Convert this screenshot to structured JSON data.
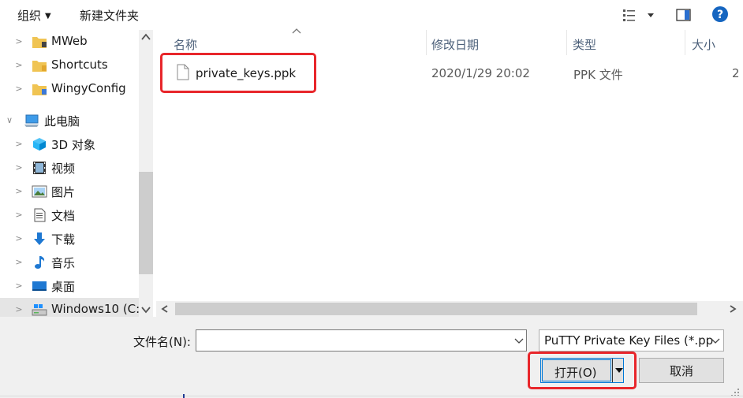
{
  "toolbar": {
    "organize_label": "组织",
    "new_folder_label": "新建文件夹",
    "view_icon": "details-view-icon",
    "pane_icon": "preview-pane-icon",
    "help_icon": "help-icon"
  },
  "nav": {
    "items": [
      {
        "label": "MWeb",
        "icon": "folder-icon"
      },
      {
        "label": "Shortcuts",
        "icon": "folder-icon"
      },
      {
        "label": "WingyConfig",
        "icon": "folder-icon"
      },
      {
        "label": "此电脑",
        "icon": "computer-icon"
      },
      {
        "label": "3D 对象",
        "icon": "3d-objects-icon"
      },
      {
        "label": "视频",
        "icon": "video-icon"
      },
      {
        "label": "图片",
        "icon": "pictures-icon"
      },
      {
        "label": "文档",
        "icon": "documents-icon"
      },
      {
        "label": "下载",
        "icon": "download-icon"
      },
      {
        "label": "音乐",
        "icon": "music-icon"
      },
      {
        "label": "桌面",
        "icon": "desktop-icon"
      },
      {
        "label": "Windows10 (C:",
        "icon": "drive-icon"
      }
    ]
  },
  "list": {
    "columns": [
      "名称",
      "修改日期",
      "类型",
      "大小"
    ],
    "rows": [
      {
        "name": "private_keys.ppk",
        "modified": "2020/1/29 20:02",
        "type": "PPK 文件",
        "size": "2"
      }
    ]
  },
  "bottom": {
    "filename_label": "文件名(N):",
    "filename_value": "",
    "filter_value": "PuTTY Private Key Files (*.pp",
    "open_label": "打开(O)",
    "cancel_label": "取消"
  },
  "colors": {
    "highlight": "#e8262b",
    "accent": "#0078d7"
  }
}
